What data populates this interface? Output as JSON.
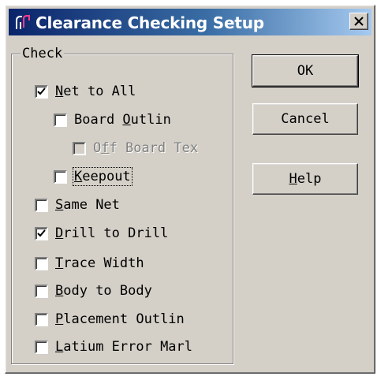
{
  "window": {
    "title": "Clearance Checking Setup",
    "close_glyph": "X",
    "icon": "app-logo-icon"
  },
  "group": {
    "label": "Check"
  },
  "checkboxes": [
    {
      "pre": "",
      "acc": "N",
      "post": "et to All",
      "checked": true,
      "enabled": true
    },
    {
      "pre": "Board ",
      "acc": "O",
      "post": "utlin",
      "checked": false,
      "enabled": true
    },
    {
      "pre": "O",
      "acc": "f",
      "post": "f Board Tex",
      "checked": false,
      "enabled": false
    },
    {
      "pre": "",
      "acc": "K",
      "post": "eepout",
      "checked": false,
      "enabled": true,
      "focused": true
    },
    {
      "pre": "",
      "acc": "S",
      "post": "ame Net",
      "checked": false,
      "enabled": true
    },
    {
      "pre": "",
      "acc": "D",
      "post": "rill to Drill",
      "checked": true,
      "enabled": true
    },
    {
      "pre": "",
      "acc": "T",
      "post": "race Width",
      "checked": false,
      "enabled": true
    },
    {
      "pre": "",
      "acc": "B",
      "post": "ody to Body",
      "checked": false,
      "enabled": true
    },
    {
      "pre": "",
      "acc": "P",
      "post": "lacement Outlin",
      "checked": false,
      "enabled": true
    },
    {
      "pre": "",
      "acc": "L",
      "post": "atium Error Marl",
      "checked": false,
      "enabled": true
    }
  ],
  "buttons": {
    "ok": {
      "label": "OK"
    },
    "cancel": {
      "label": "Cancel"
    },
    "help": {
      "acc": "H",
      "post": "elp"
    }
  },
  "colors": {
    "titlebar_start": "#0a246a",
    "titlebar_end": "#a6caf0",
    "face": "#d4d0c8"
  }
}
